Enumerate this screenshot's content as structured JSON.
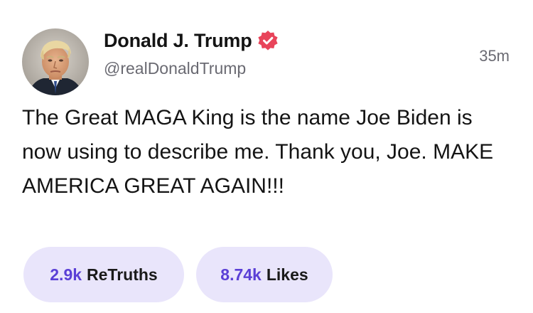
{
  "post": {
    "author": {
      "display_name": "Donald J. Trump",
      "handle": "@realDonaldTrump",
      "verified": true,
      "verified_icon": "verified-badge-icon",
      "verified_color": "#e8445a"
    },
    "timestamp": "35m",
    "text": "The Great MAGA King is the name Joe Biden is now using to describe me. Thank you, Joe. MAKE AMERICA GREAT AGAIN!!!",
    "actions": {
      "retruths": {
        "count": "2.9k",
        "label": "ReTruths"
      },
      "likes": {
        "count": "8.74k",
        "label": "Likes"
      }
    }
  },
  "colors": {
    "accent": "#5a3fd6",
    "pill_background": "#e9e5fb",
    "text_primary": "#141414",
    "text_secondary": "#6a6a72"
  }
}
